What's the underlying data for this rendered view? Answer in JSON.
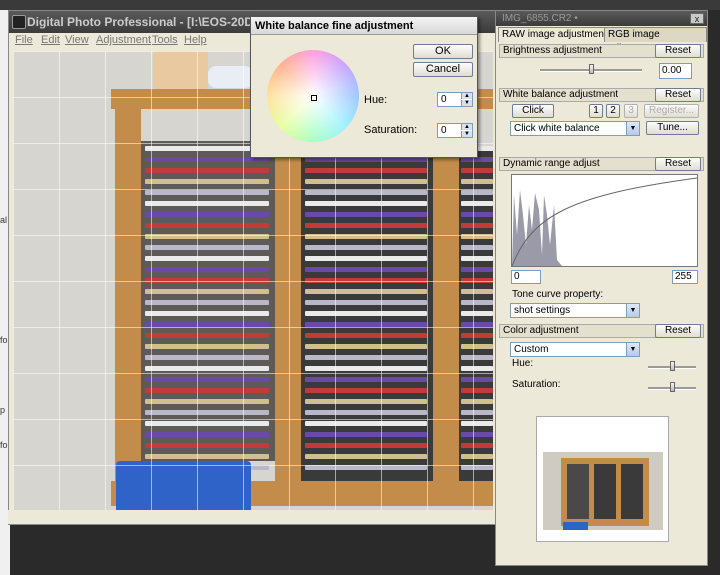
{
  "app": {
    "title": "Digital Photo Professional - [I:\\EOS-20DW",
    "menu": [
      "File",
      "Edit",
      "View",
      "Adjustment",
      "Tools",
      "Help"
    ]
  },
  "left_fragments": [
    "al",
    "fo",
    "p",
    "fo"
  ],
  "palette": {
    "title": "IMG_6855.CR2 •",
    "close_glyph": "x",
    "tabs": [
      "RAW image adjustment",
      "RGB image adjustment"
    ],
    "brightness": {
      "label": "Brightness adjustment",
      "reset": "Reset",
      "value": "0.00"
    },
    "white_balance": {
      "label": "White balance adjustment",
      "reset": "Reset",
      "click": "Click",
      "buttons": [
        "1",
        "2",
        "3"
      ],
      "register": "Register...",
      "preset": "Click white balance",
      "tune": "Tune..."
    },
    "dynamic_range": {
      "label": "Dynamic range adjust",
      "reset": "Reset",
      "min": "0",
      "max": "255",
      "tone_curve_label": "Tone curve property:",
      "tone_curve_value": "shot settings"
    },
    "color": {
      "label": "Color adjustment",
      "reset": "Reset",
      "mode": "Custom",
      "hue_label": "Hue:",
      "saturation_label": "Saturation:"
    }
  },
  "wb_dialog": {
    "title": "White balance fine adjustment",
    "ok": "OK",
    "cancel": "Cancel",
    "hue_label": "Hue:",
    "hue_value": "0",
    "saturation_label": "Saturation:",
    "saturation_value": "0"
  },
  "colors": {
    "titlebar_dark": "#3b3b3b",
    "panel_bg": "#ece9d8",
    "wood": "#c48c4a",
    "container_blue": "#2f63c8"
  }
}
